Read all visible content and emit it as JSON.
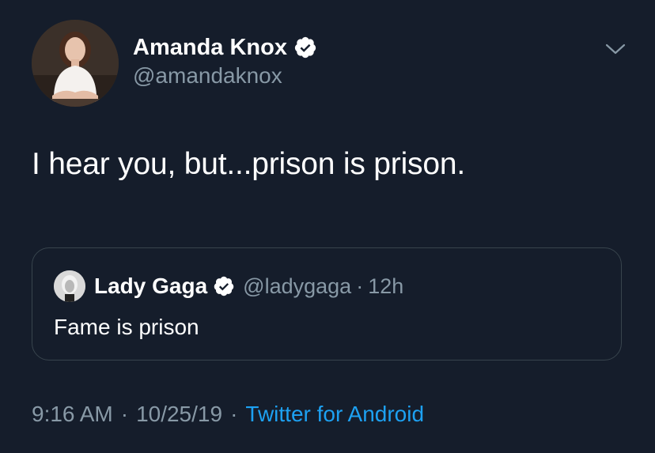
{
  "author": {
    "display_name": "Amanda Knox",
    "handle": "@amandaknox",
    "verified": true,
    "avatar_icon": "profile-photo"
  },
  "tweet": {
    "text": "I hear you, but...prison is prison."
  },
  "quoted_tweet": {
    "display_name": "Lady Gaga",
    "handle": "@ladygaga",
    "separator": "·",
    "time": "12h",
    "text": "Fame is prison",
    "verified": true
  },
  "meta": {
    "time": "9:16 AM",
    "separator": "·",
    "date": "10/25/19",
    "source": "Twitter for Android"
  },
  "colors": {
    "background": "#151d2b",
    "primary_text": "#ffffff",
    "secondary_text": "#8899a6",
    "link": "#1da1f2",
    "border": "#38444d"
  }
}
